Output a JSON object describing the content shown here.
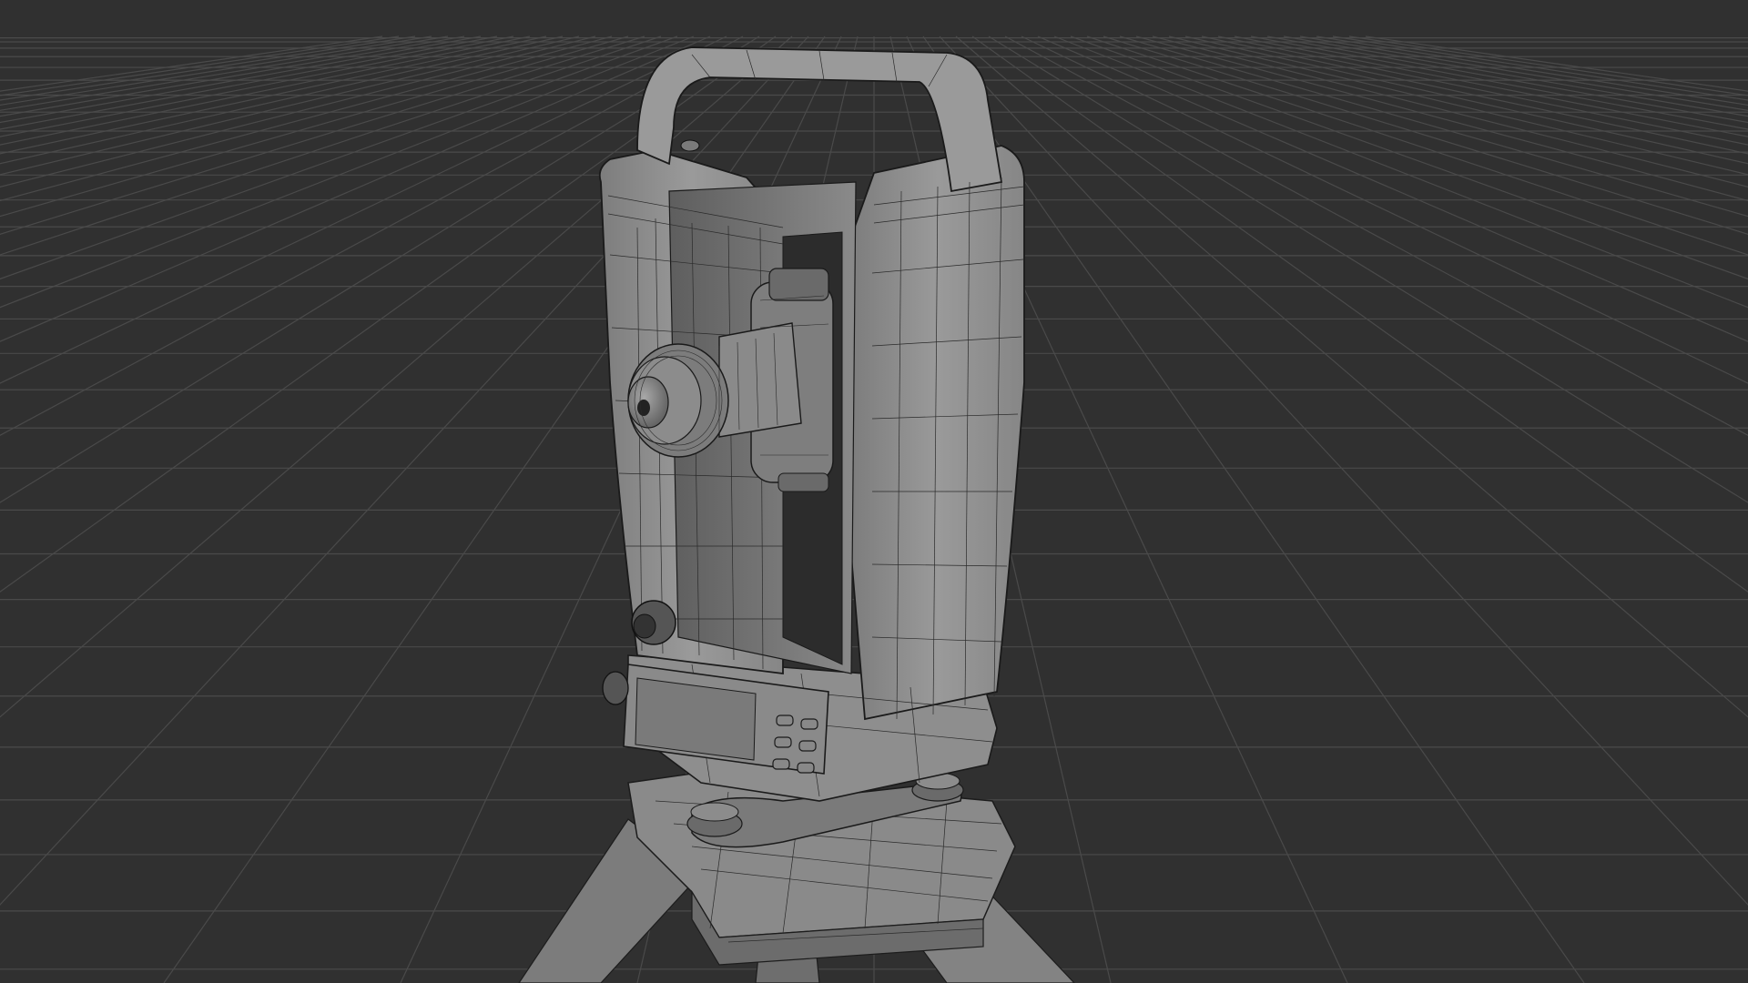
{
  "viewport": {
    "mode": "3d-viewport",
    "shading": "solid-with-wireframe-overlay",
    "background_color": "#303030",
    "grid_color": "#4a4a4a",
    "mesh_color": "#8e8e8e",
    "wire_color": "#1a1a1a",
    "object": "theodolite-on-tripod-mesh"
  }
}
